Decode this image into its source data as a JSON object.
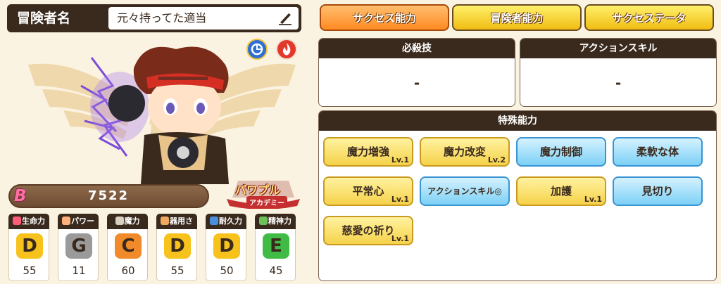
{
  "header": {
    "name_label": "冒険者名",
    "name_value": "元々持ってた適当"
  },
  "rank": {
    "letter": "B",
    "value": "7522"
  },
  "logo": {
    "text": "パワプル",
    "sub": "アカデミー"
  },
  "stats": [
    {
      "label": "生命力",
      "grade": "D",
      "value": "55",
      "color": "#f6c21b",
      "icon": "heart-icon"
    },
    {
      "label": "パワー",
      "grade": "G",
      "value": "11",
      "color": "#9a9a9a",
      "icon": "arm-icon"
    },
    {
      "label": "魔力",
      "grade": "C",
      "value": "60",
      "color": "#f08a2a",
      "icon": "magic-icon"
    },
    {
      "label": "器用さ",
      "grade": "D",
      "value": "55",
      "color": "#f6c21b",
      "icon": "hand-icon"
    },
    {
      "label": "耐久力",
      "grade": "D",
      "value": "50",
      "color": "#f6c21b",
      "icon": "shield-icon"
    },
    {
      "label": "精神力",
      "grade": "E",
      "value": "45",
      "color": "#3fbb46",
      "icon": "spirit-icon"
    }
  ],
  "tabs": [
    {
      "label": "サクセス能力",
      "active": true
    },
    {
      "label": "冒険者能力",
      "active": false
    },
    {
      "label": "サクセステータ",
      "active": false
    }
  ],
  "panels": {
    "special_skill": {
      "title": "必殺技",
      "value": "-"
    },
    "action_skill": {
      "title": "アクションスキル",
      "value": "-"
    },
    "special_abilities": {
      "title": "特殊能力"
    }
  },
  "abilities": [
    {
      "label": "魔力増強",
      "style": "gold",
      "level": "Lv.1"
    },
    {
      "label": "魔力改変",
      "style": "gold",
      "level": "Lv.2"
    },
    {
      "label": "魔力制御",
      "style": "blue",
      "level": ""
    },
    {
      "label": "柔軟な体",
      "style": "blue",
      "level": ""
    },
    {
      "label": "平常心",
      "style": "gold",
      "level": "Lv.1"
    },
    {
      "label": "アクションスキル◎",
      "style": "blue",
      "level": ""
    },
    {
      "label": "加護",
      "style": "gold",
      "level": "Lv.1"
    },
    {
      "label": "見切り",
      "style": "blue",
      "level": ""
    },
    {
      "label": "慈愛の祈り",
      "style": "gold",
      "level": "Lv.1"
    }
  ]
}
